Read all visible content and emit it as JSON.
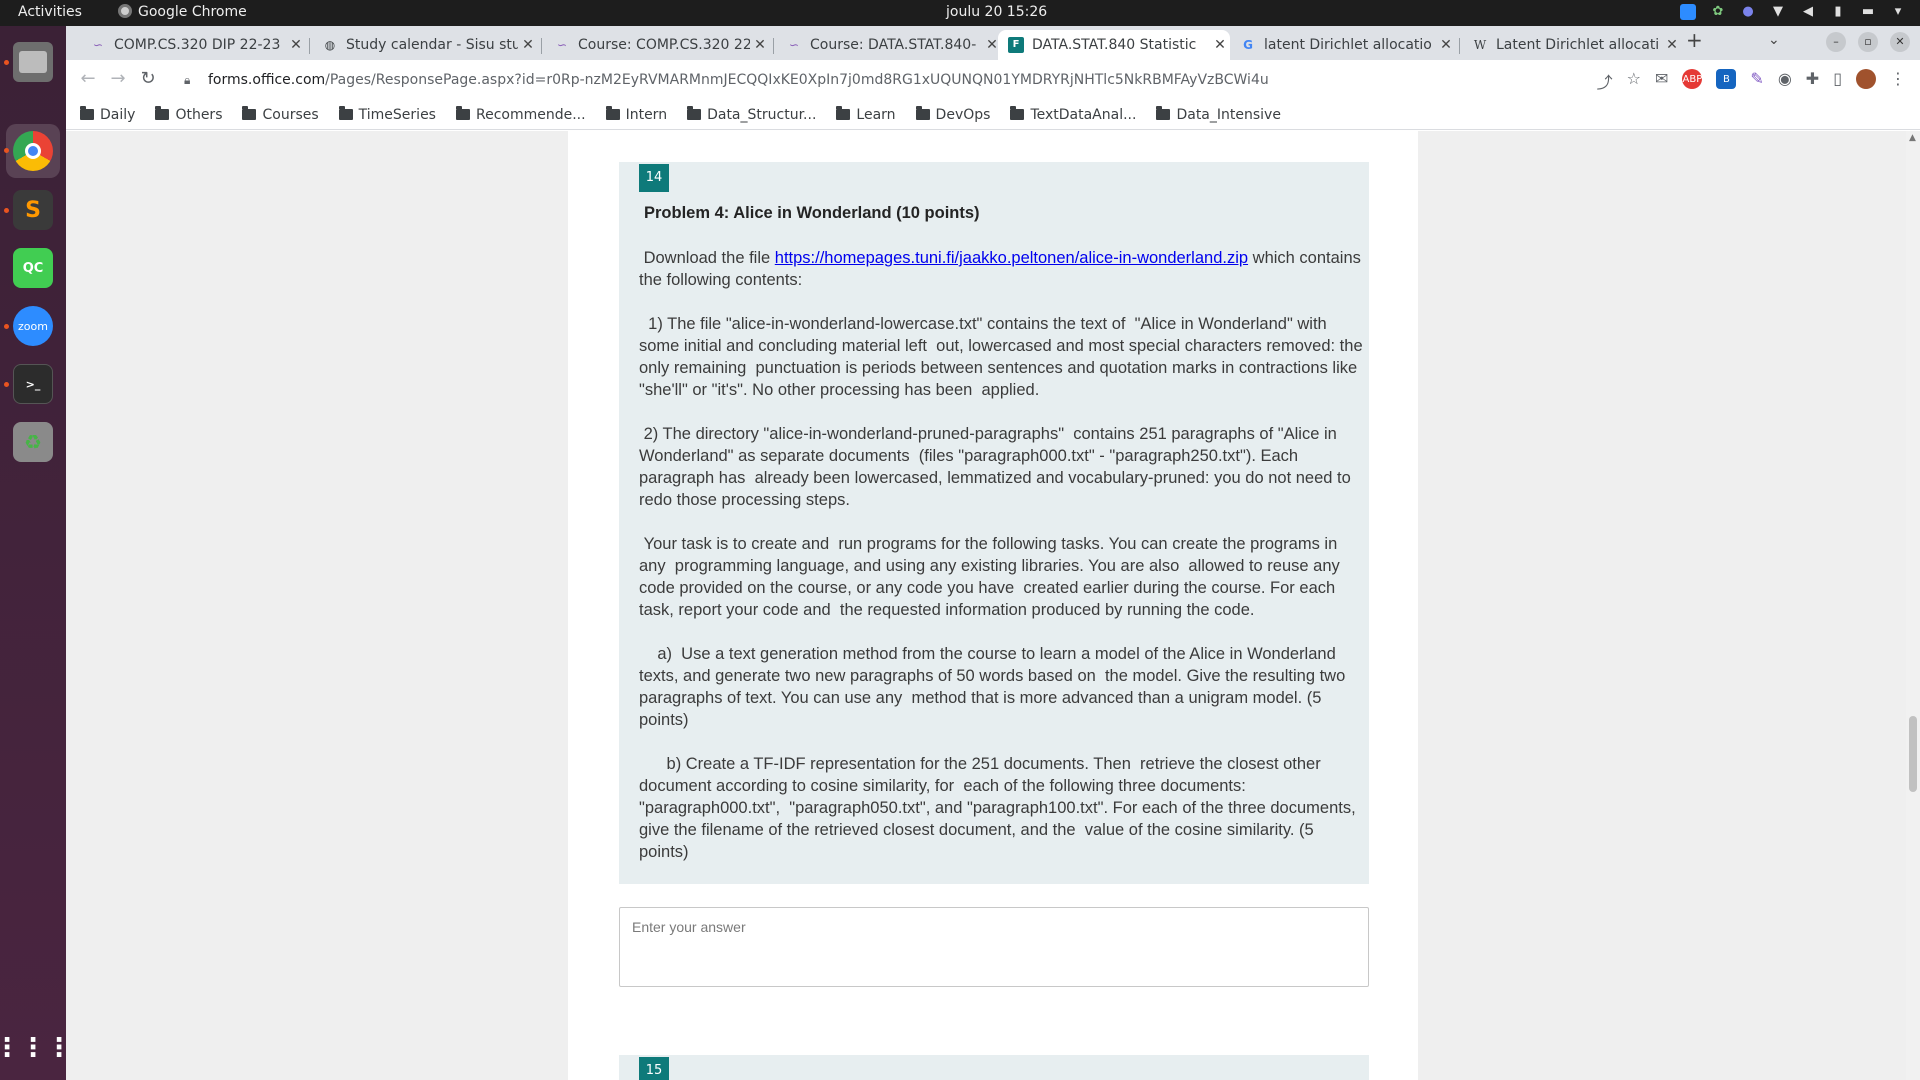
{
  "topbar": {
    "activities": "Activities",
    "app_name": "Google Chrome",
    "clock": "joulu 20  15:26"
  },
  "dock": {
    "items": [
      "files",
      "chrome",
      "sublime",
      "qtcreator",
      "zoom",
      "terminal",
      "trash"
    ],
    "zoom_label": "zoom",
    "qc_label": "QC",
    "sublime_label": "S",
    "terminal_label": ">_"
  },
  "tabs": [
    {
      "title": "COMP.CS.320 DIP 22-23",
      "favicon": "sisu-icon",
      "active": false
    },
    {
      "title": "Study calendar - Sisu stu",
      "favicon": "globe-icon",
      "active": false
    },
    {
      "title": "Course: COMP.CS.320 22",
      "favicon": "moodle-icon",
      "active": false
    },
    {
      "title": "Course: DATA.STAT.840-",
      "favicon": "moodle-icon",
      "active": false
    },
    {
      "title": "DATA.STAT.840 Statistic",
      "favicon": "forms-icon",
      "active": true
    },
    {
      "title": "latent Dirichlet allocatio",
      "favicon": "google-icon",
      "active": false
    },
    {
      "title": "Latent Dirichlet allocati",
      "favicon": "wikipedia-icon",
      "active": false
    }
  ],
  "toolbar": {
    "url_host": "forms.office.com",
    "url_rest": "/Pages/ResponsePage.aspx?id=r0Rp-nzM2EyRVMARMnmJECQQIxKE0XpIn7j0md8RG1xUQUNQN01YMDRYRjNHTlc5NkRBMFAyVzBCWi4u"
  },
  "bookmarks": [
    "Daily",
    "Others",
    "Courses",
    "TimeSeries",
    "Recommende...",
    "Intern",
    "Data_Structur...",
    "Learn",
    "DevOps",
    "TextDataAnal...",
    "Data_Intensive"
  ],
  "question": {
    "number": "14",
    "title": "Problem 4: Alice in Wonderland (10 points)",
    "intro_before_link": " Download the file ",
    "link": "https://homepages.tuni.fi/jaakko.peltonen/alice-in-wonderland.zip",
    "intro_after_link": " which contains the following contents:",
    "p1": "  1) The file \"alice-in-wonderland-lowercase.txt\" contains the text of  \"Alice in Wonderland\" with some initial and concluding material left  out, lowercased and most special characters removed: the only remaining  punctuation is periods between sentences and quotation marks in contractions like \"she'll\" or \"it's\". No other processing has been  applied.",
    "p2": " 2) The directory \"alice-in-wonderland-pruned-paragraphs\"  contains 251 paragraphs of \"Alice in Wonderland\" as separate documents  (files \"paragraph000.txt\" - \"paragraph250.txt\"). Each paragraph has  already been lowercased, lemmatized and vocabulary-pruned: you do not need to redo those processing steps.",
    "p3": " Your task is to create and  run programs for the following tasks. You can create the programs in any  programming language, and using any existing libraries. You are also  allowed to reuse any code provided on the course, or any code you have  created earlier during the course. For each task, report your code and  the requested information produced by running the code.",
    "p4": "    a)  Use a text generation method from the course to learn a model of the Alice in Wonderland texts, and generate two new paragraphs of 50 words based on  the model. Give the resulting two paragraphs of text. You can use any  method that is more advanced than a unigram model. (5 points)",
    "p5": "      b) Create a TF-IDF representation for the 251 documents. Then  retrieve the closest other document according to cosine similarity, for  each of the following three documents: \"paragraph000.txt\",  \"paragraph050.txt\", and \"paragraph100.txt\". For each of the three documents, give the filename of the retrieved closest document, and the  value of the cosine similarity. (5 points)",
    "answer_placeholder": "Enter your answer"
  },
  "next_question": {
    "number": "15"
  },
  "colors": {
    "accent": "#0e7a7a",
    "question_bg": "#e7eef0",
    "link": "#0000ee"
  }
}
